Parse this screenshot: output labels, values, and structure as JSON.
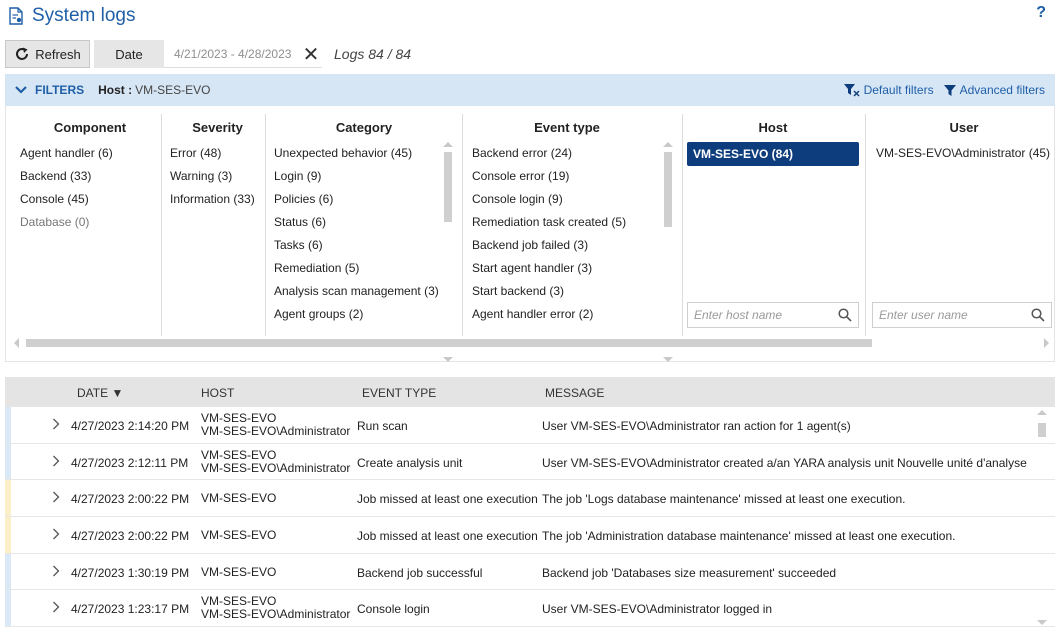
{
  "header": {
    "title": "System logs",
    "help_label": "?",
    "icon": "document-gear-icon"
  },
  "toolbar": {
    "refresh_label": "Refresh",
    "date_label": "Date",
    "date_range": "4/21/2023 - 4/28/2023",
    "clear_icon": "close-icon",
    "logs_count": "Logs 84 / 84"
  },
  "filters_bar": {
    "label": "FILTERS",
    "host_key": "Host :",
    "host_value": "VM-SES-EVO",
    "default_filters": "Default filters",
    "advanced_filters": "Advanced filters"
  },
  "filters": {
    "component": {
      "header": "Component",
      "items": [
        "Agent handler (6)",
        "Backend (33)",
        "Console (45)",
        "Database (0)"
      ]
    },
    "severity": {
      "header": "Severity",
      "items": [
        "Error (48)",
        "Warning (3)",
        "Information (33)"
      ]
    },
    "category": {
      "header": "Category",
      "items": [
        "Unexpected behavior (45)",
        "Login (9)",
        "Policies (6)",
        "Status (6)",
        "Tasks (6)",
        "Remediation (5)",
        "Analysis scan management (3)",
        "Agent groups (2)"
      ]
    },
    "event_type": {
      "header": "Event type",
      "items": [
        "Backend error (24)",
        "Console error (19)",
        "Console login (9)",
        "Remediation task created (5)",
        "Backend job failed (3)",
        "Start agent handler (3)",
        "Start backend (3)",
        "Agent handler error (2)"
      ]
    },
    "host": {
      "header": "Host",
      "selected": "VM-SES-EVO (84)",
      "search_placeholder": "Enter host name"
    },
    "user": {
      "header": "User",
      "items": [
        "VM-SES-EVO\\Administrator (45)"
      ],
      "search_placeholder": "Enter user name"
    }
  },
  "table": {
    "columns": {
      "date": "DATE ▼",
      "host": "HOST",
      "event_type": "EVENT TYPE",
      "message": "MESSAGE"
    },
    "rows": [
      {
        "date": "4/27/2023 2:14:20 PM",
        "host": "VM-SES-EVO",
        "user": "VM-SES-EVO\\Administrator",
        "event": "Run scan",
        "message": "User VM-SES-EVO\\Administrator ran action for 1 agent(s)",
        "severity_color": "#dbe9f7"
      },
      {
        "date": "4/27/2023 2:12:11 PM",
        "host": "VM-SES-EVO",
        "user": "VM-SES-EVO\\Administrator",
        "event": "Create analysis unit",
        "message": "User VM-SES-EVO\\Administrator created a/an YARA analysis unit Nouvelle unité d'analyse",
        "severity_color": "#dbe9f7"
      },
      {
        "date": "4/27/2023 2:00:22 PM",
        "host": "VM-SES-EVO",
        "user": "",
        "event": "Job missed at least one execution",
        "message": "The job 'Logs database maintenance' missed at least one execution.",
        "severity_color": "#fbefc8"
      },
      {
        "date": "4/27/2023 2:00:22 PM",
        "host": "VM-SES-EVO",
        "user": "",
        "event": "Job missed at least one execution",
        "message": "The job 'Administration database maintenance' missed at least one execution.",
        "severity_color": "#fbefc8"
      },
      {
        "date": "4/27/2023 1:30:19 PM",
        "host": "VM-SES-EVO",
        "user": "",
        "event": "Backend job successful",
        "message": "Backend job 'Databases size measurement' succeeded",
        "severity_color": "#dbe9f7"
      },
      {
        "date": "4/27/2023 1:23:17 PM",
        "host": "VM-SES-EVO",
        "user": "VM-SES-EVO\\Administrator",
        "event": "Console login",
        "message": "User VM-SES-EVO\\Administrator logged in",
        "severity_color": "#dbe9f7"
      }
    ]
  },
  "colors": {
    "accent": "#1f5fa8",
    "selected": "#0e3d7d",
    "filter_bar": "#d7e6f5"
  }
}
